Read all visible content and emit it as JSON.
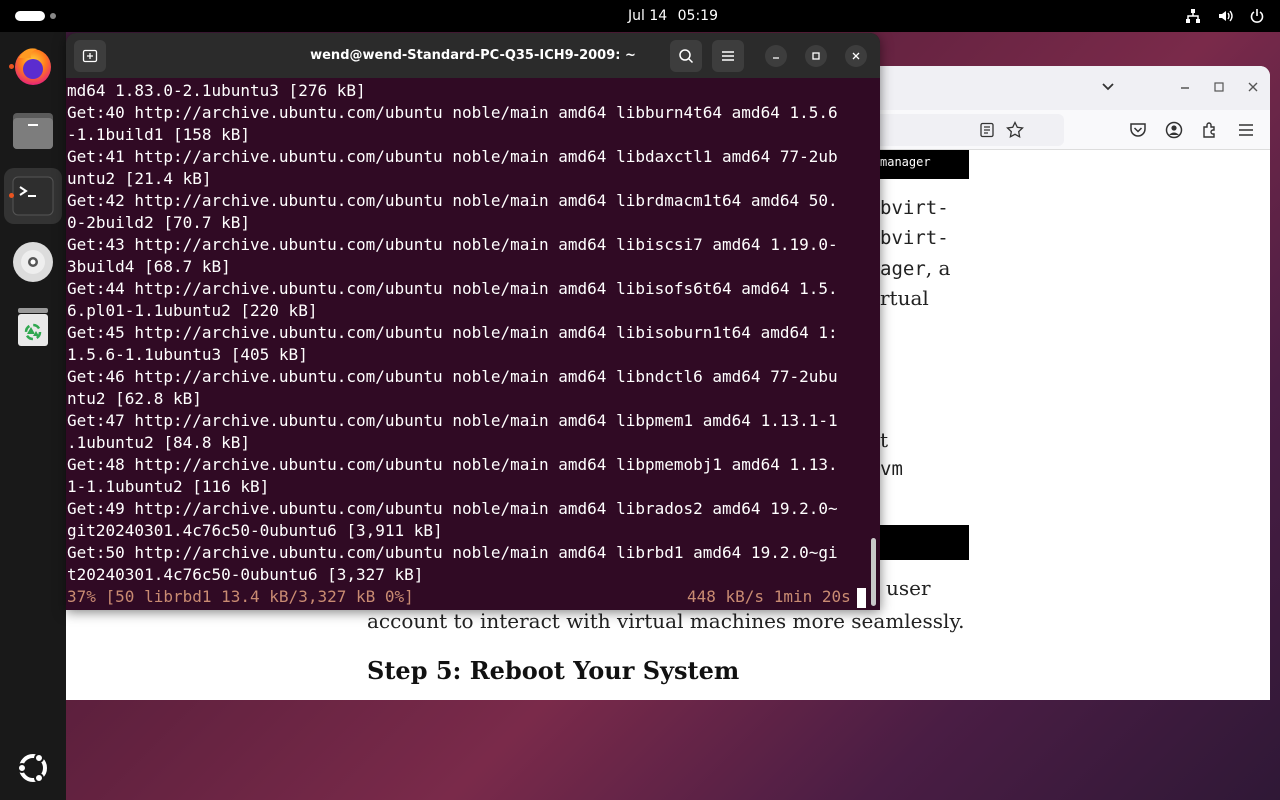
{
  "topbar": {
    "date": "Jul 14",
    "time": "05:19"
  },
  "tray_icons": [
    "network-icon",
    "volume-icon",
    "power-icon"
  ],
  "dock": {
    "items": [
      {
        "name": "firefox-icon",
        "active": false,
        "running": true
      },
      {
        "name": "files-icon",
        "active": false,
        "running": false
      },
      {
        "name": "terminal-icon",
        "active": true,
        "running": true
      },
      {
        "name": "disc-icon",
        "active": false,
        "running": false
      },
      {
        "name": "trash-icon",
        "active": false,
        "running": false
      }
    ],
    "apps_grid": "ubuntu-logo-icon"
  },
  "terminal": {
    "title": "wend@wend-Standard-PC-Q35-ICH9-2009: ~",
    "lines": [
      "md64 1.83.0-2.1ubuntu3 [276 kB]",
      "Get:40 http://archive.ubuntu.com/ubuntu noble/main amd64 libburn4t64 amd64 1.5.6",
      "-1.1build1 [158 kB]",
      "Get:41 http://archive.ubuntu.com/ubuntu noble/main amd64 libdaxctl1 amd64 77-2ub",
      "untu2 [21.4 kB]",
      "Get:42 http://archive.ubuntu.com/ubuntu noble/main amd64 librdmacm1t64 amd64 50.",
      "0-2build2 [70.7 kB]",
      "Get:43 http://archive.ubuntu.com/ubuntu noble/main amd64 libiscsi7 amd64 1.19.0-",
      "3build4 [68.7 kB]",
      "Get:44 http://archive.ubuntu.com/ubuntu noble/main amd64 libisofs6t64 amd64 1.5.",
      "6.pl01-1.1ubuntu2 [220 kB]",
      "Get:45 http://archive.ubuntu.com/ubuntu noble/main amd64 libisoburn1t64 amd64 1:",
      "1.5.6-1.1ubuntu3 [405 kB]",
      "Get:46 http://archive.ubuntu.com/ubuntu noble/main amd64 libndctl6 amd64 77-2ubu",
      "ntu2 [62.8 kB]",
      "Get:47 http://archive.ubuntu.com/ubuntu noble/main amd64 libpmem1 amd64 1.13.1-1",
      ".1ubuntu2 [84.8 kB]",
      "Get:48 http://archive.ubuntu.com/ubuntu noble/main amd64 libpmemobj1 amd64 1.13.",
      "1-1.1ubuntu2 [116 kB]",
      "Get:49 http://archive.ubuntu.com/ubuntu noble/main amd64 librados2 amd64 19.2.0~",
      "git20240301.4c76c50-0ubuntu6 [3,911 kB]",
      "Get:50 http://archive.ubuntu.com/ubuntu noble/main amd64 librbd1 amd64 19.2.0~gi",
      "t20240301.4c76c50-0ubuntu6 [3,327 kB]"
    ],
    "status_left": "37% [50 librbd1 13.4 kB/3,327 kB 0%]",
    "status_right": "448 kB/s 1min 20s"
  },
  "browser": {
    "code_snippet": "manager",
    "fragments": {
      "f1": "bvirt-",
      "f2": "bvirt-",
      "f3a": "ager",
      "f3b": ", a",
      "f4": "rtual",
      "f5": "t",
      "f6": "vm",
      "f7": "user"
    },
    "paragraph_line2": "account to interact with virtual machines more seamlessly.",
    "heading": "Step 5: Reboot Your System"
  }
}
